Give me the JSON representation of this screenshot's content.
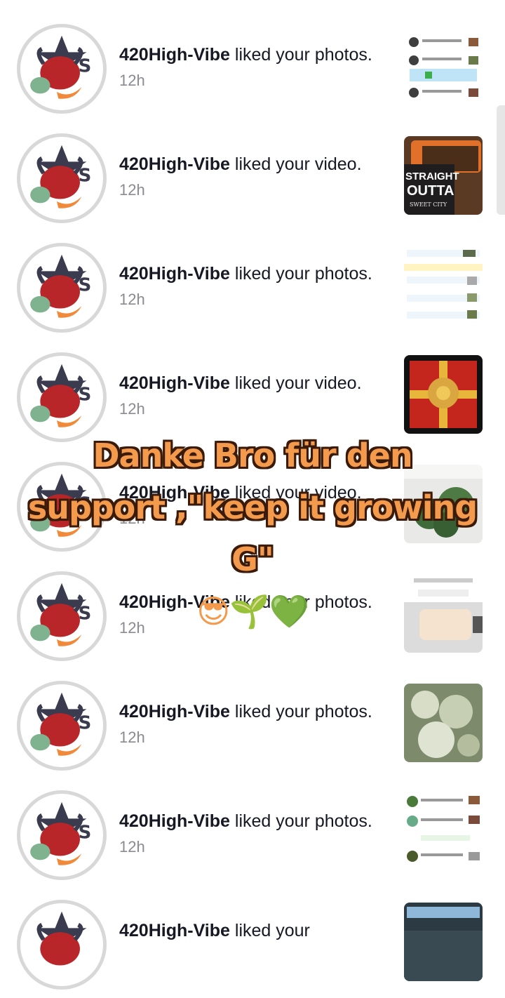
{
  "notifications": [
    {
      "user": "420High-Vibe",
      "action": " liked your photos.",
      "time": "12h",
      "thumb": "photos-screenshot"
    },
    {
      "user": "420High-Vibe",
      "action": " liked your video.",
      "time": "12h",
      "thumb": "straight-outta-video"
    },
    {
      "user": "420High-Vibe",
      "action": " liked your photos.",
      "time": "12h",
      "thumb": "photos-screenshot"
    },
    {
      "user": "420High-Vibe",
      "action": " liked your video.",
      "time": "12h",
      "thumb": "gift-bow-video"
    },
    {
      "user": "420High-Vibe",
      "action": " liked your video.",
      "time": "12h",
      "thumb": "plant-video"
    },
    {
      "user": "420High-Vibe",
      "action": " liked your photos.",
      "time": "12h",
      "thumb": "profile-screenshot"
    },
    {
      "user": "420High-Vibe",
      "action": " liked your photos.",
      "time": "12h",
      "thumb": "flower-closeup"
    },
    {
      "user": "420High-Vibe",
      "action": " liked your photos.",
      "time": "12h",
      "thumb": "comments-screenshot"
    },
    {
      "user": "420High-Vibe",
      "action": " liked your",
      "time": "",
      "thumb": "night-video"
    }
  ],
  "thumb_labels": {
    "straight_outta_1": "STRAIGHT",
    "straight_outta_2": "OUTTA",
    "straight_outta_3": "SWEET CITY"
  },
  "overlay": {
    "line1": "Danke Bro für den",
    "line2": "support ,\"keep it growing",
    "line3": "G\"",
    "emojis": "😎🌱💚"
  },
  "colors": {
    "caption_fill": "#f39a4d",
    "caption_outline": "#3a1a08",
    "time_gray": "#8a8b91"
  }
}
